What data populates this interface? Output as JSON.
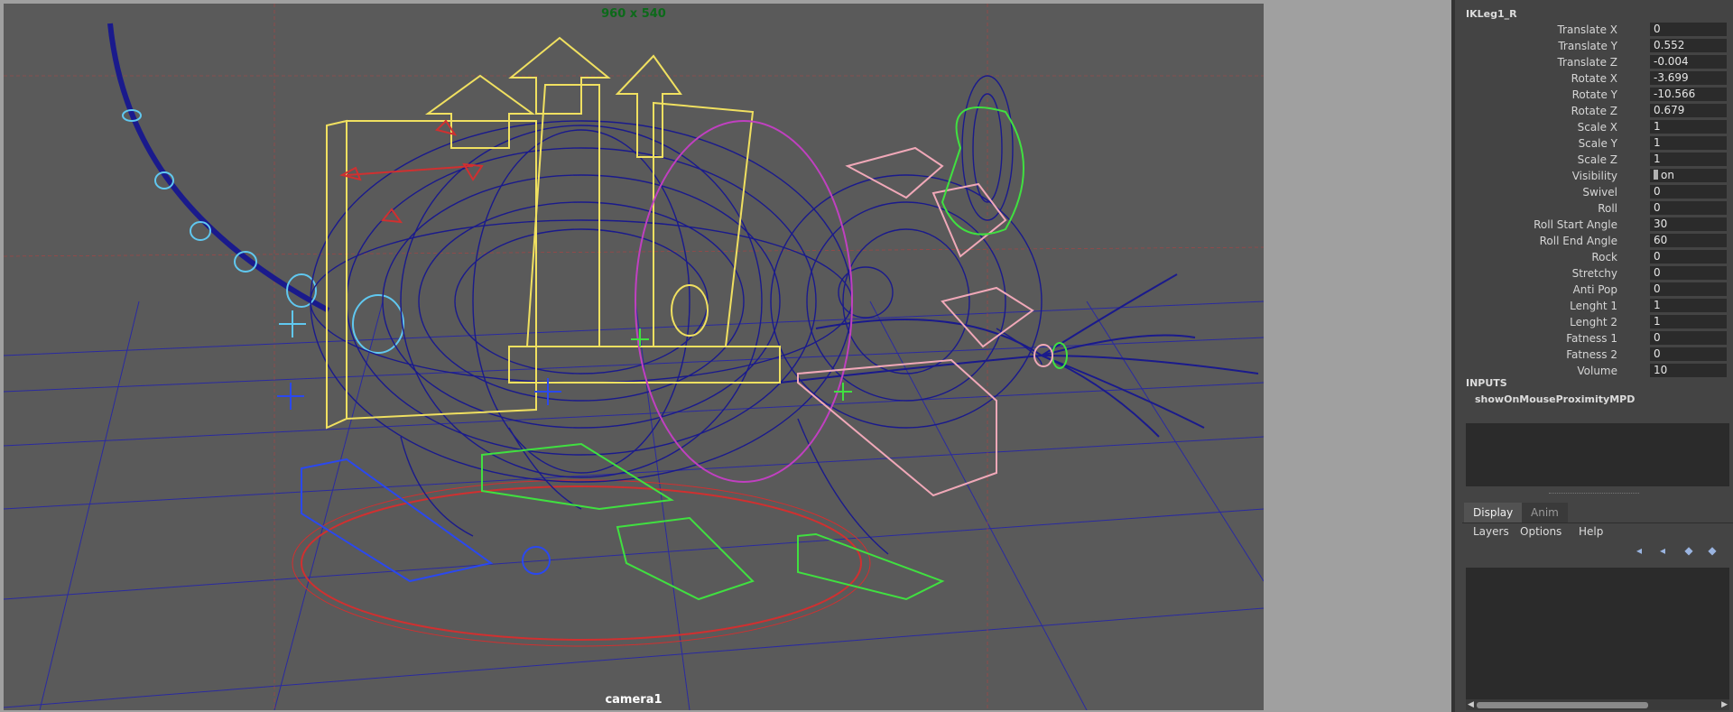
{
  "viewport": {
    "resolution_label": "960 x 540",
    "camera_label": "camera1"
  },
  "channel_box": {
    "node_name": "IKLeg1_R",
    "attributes": [
      {
        "label": "Translate X",
        "value": "0"
      },
      {
        "label": "Translate Y",
        "value": "0.552"
      },
      {
        "label": "Translate Z",
        "value": "-0.004"
      },
      {
        "label": "Rotate X",
        "value": "-3.699"
      },
      {
        "label": "Rotate Y",
        "value": "-10.566"
      },
      {
        "label": "Rotate Z",
        "value": "0.679"
      },
      {
        "label": "Scale X",
        "value": "1"
      },
      {
        "label": "Scale Y",
        "value": "1"
      },
      {
        "label": "Scale Z",
        "value": "1"
      },
      {
        "label": "Visibility",
        "value": "on"
      },
      {
        "label": "Swivel",
        "value": "0"
      },
      {
        "label": "Roll",
        "value": "0"
      },
      {
        "label": "Roll Start Angle",
        "value": "30"
      },
      {
        "label": "Roll End Angle",
        "value": "60"
      },
      {
        "label": "Rock",
        "value": "0"
      },
      {
        "label": "Stretchy",
        "value": "0"
      },
      {
        "label": "Anti Pop",
        "value": "0"
      },
      {
        "label": "Lenght 1",
        "value": "1"
      },
      {
        "label": "Lenght 2",
        "value": "1"
      },
      {
        "label": "Fatness 1",
        "value": "0"
      },
      {
        "label": "Fatness 2",
        "value": "0"
      },
      {
        "label": "Volume",
        "value": "10"
      }
    ],
    "inputs_title": "INPUTS",
    "inputs_item": "showOnMouseProximityMPD"
  },
  "layer_editor": {
    "tabs": [
      {
        "label": "Display",
        "active": true
      },
      {
        "label": "Anim",
        "active": false
      }
    ],
    "menu": [
      "Layers",
      "Options",
      "Help"
    ],
    "icons": [
      "move-layer-up-icon",
      "move-layer-down-icon",
      "new-layer-icon",
      "new-layer-from-selection-icon"
    ]
  },
  "colors": {
    "viewport_bg": "#5a5a5a",
    "wireframe": "#1a1a8c",
    "control_yellow": "#f0e060",
    "control_green": "#40e040",
    "control_pink": "#f0a8b8",
    "control_cyan": "#60c8f0",
    "ground_red": "#d03030"
  }
}
